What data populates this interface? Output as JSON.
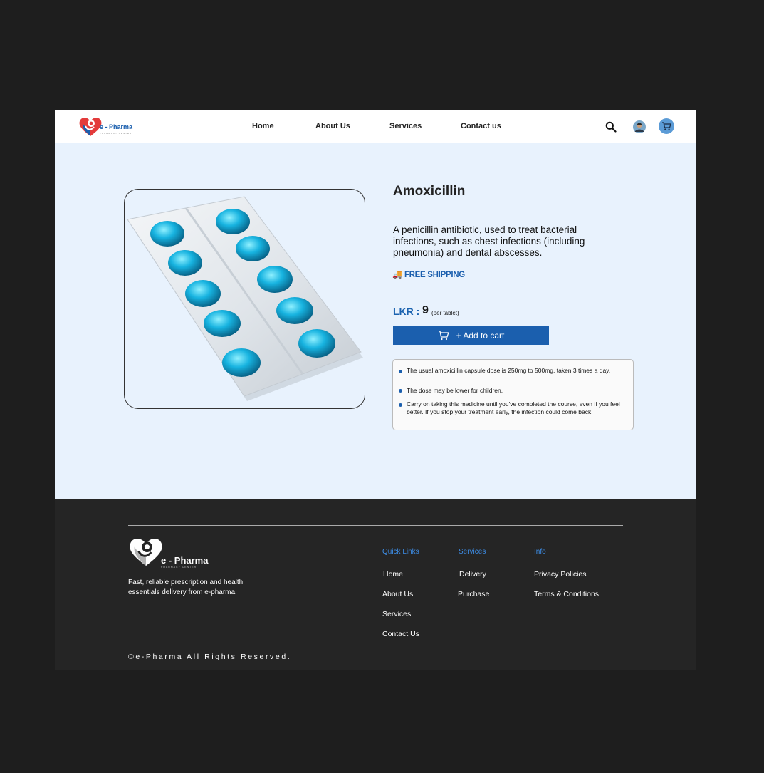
{
  "header": {
    "brand": "e - Pharma",
    "brand_sub": "PHARMACY CENTER",
    "nav": [
      "Home",
      "About Us",
      "Services",
      "Contact us"
    ]
  },
  "product": {
    "name": "Amoxicillin",
    "description": "A penicillin antibiotic, used to treat bacterial infections, such as chest infections (including pneumonia) and dental abscesses.",
    "shipping_icon": "🚚",
    "shipping": "FREE SHIPPING",
    "price_label": "LKR :",
    "price": "9",
    "price_unit": "(per tablet)",
    "add_to_cart": "+ Add to cart",
    "info": [
      "The usual amoxicillin capsule dose is 250mg to 500mg, taken 3 times a day.",
      "The dose may be lower for children.",
      "Carry on taking this medicine until you've completed the course, even if you feel better. If you stop your treatment early, the infection could come back."
    ]
  },
  "footer": {
    "brand": "e - Pharma",
    "brand_sub": "PHARMACY CENTER",
    "tagline": "Fast, reliable prescription and health essentials delivery from e-pharma.",
    "quick_links": {
      "title": "Quick Links",
      "items": [
        "Home",
        "About Us",
        "Services",
        "Contact Us"
      ]
    },
    "services": {
      "title": "Services",
      "items": [
        "Delivery",
        "Purchase"
      ]
    },
    "info": {
      "title": "Info",
      "items": [
        "Privacy Policies",
        "Terms & Conditions"
      ]
    },
    "copyright": "©e-Pharma All Rights Reserved."
  },
  "colors": {
    "accent": "#1b5fae",
    "page_bg": "#e8f2fd",
    "footer_bg": "#252525",
    "link_blue": "#3d8ee8"
  },
  "icons": [
    "heart-logo-icon",
    "search-icon",
    "user-avatar-icon",
    "cart-icon",
    "truck-icon",
    "cart-button-icon"
  ]
}
